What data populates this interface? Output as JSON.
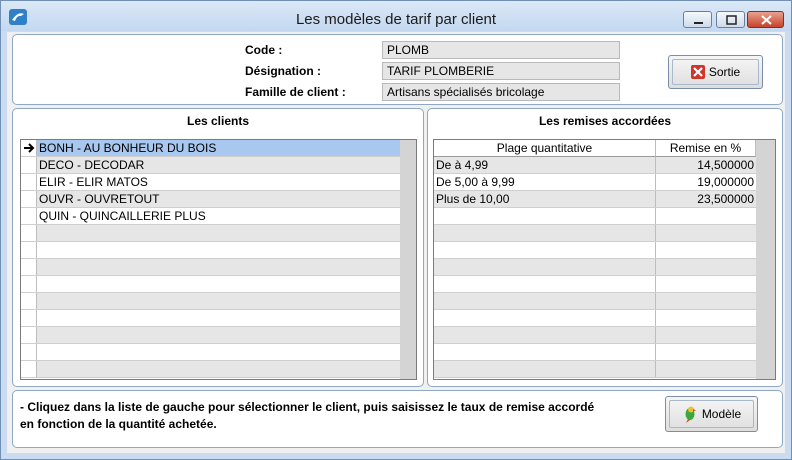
{
  "window": {
    "title": "Les modèles de tarif par client"
  },
  "header": {
    "code_label": "Code :",
    "code_value": "PLOMB",
    "designation_label": "Désignation :",
    "designation_value": "TARIF PLOMBERIE",
    "family_label": "Famille de client :",
    "family_value": "Artisans spécialisés bricolage",
    "exit_button": "Sortie"
  },
  "clients": {
    "title": "Les clients",
    "selected_index": 0,
    "rows": [
      "BONH - AU BONHEUR DU BOIS",
      "DECO - DECODAR",
      "ELIR - ELIR MATOS",
      "OUVR - OUVRETOUT",
      "QUIN - QUINCAILLERIE PLUS"
    ]
  },
  "discounts": {
    "title": "Les remises accordées",
    "col_range": "Plage quantitative",
    "col_discount": "Remise en %",
    "rows": [
      {
        "range": "De  à 4,99",
        "discount": "14,500000"
      },
      {
        "range": "De 5,00 à 9,99",
        "discount": "19,000000"
      },
      {
        "range": " Plus de 10,00",
        "discount": "23,500000"
      }
    ]
  },
  "footer": {
    "help_line1": "- Cliquez dans la liste de gauche pour sélectionner le client, puis saisissez le taux de remise accordé",
    "help_line2": "en fonction de la quantité achetée.",
    "model_button": "Modèle"
  },
  "icons": {
    "app": "app-icon",
    "exit": "close-x-icon",
    "model": "parrot-icon",
    "row_pointer": "arrow-right-icon"
  },
  "colors": {
    "selected_row": "#a8c8f0",
    "panel_border": "#8fa8c6",
    "exit_icon": "#d0342c"
  }
}
